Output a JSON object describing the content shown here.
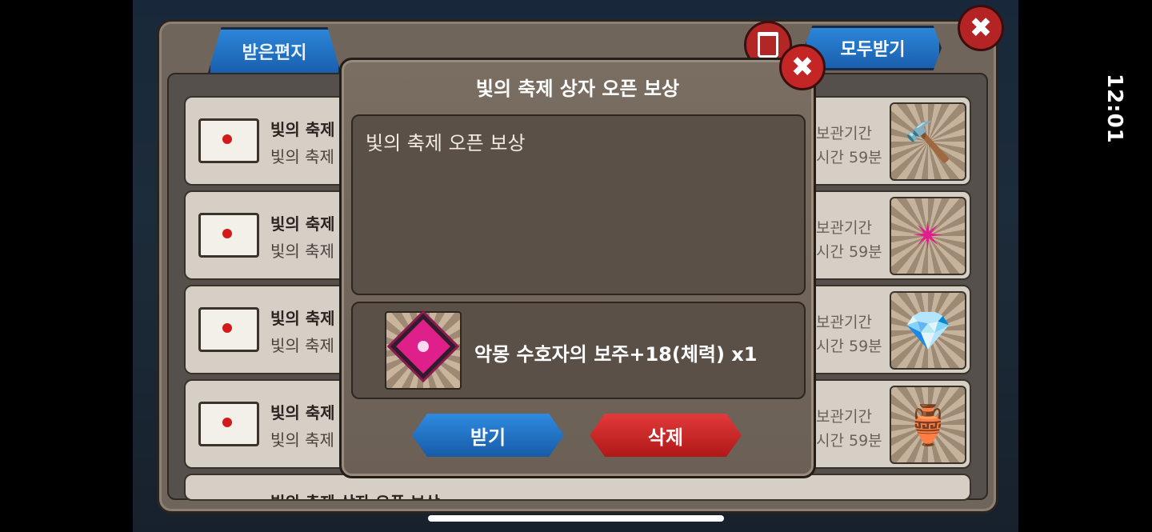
{
  "status_bar": {
    "time": "12:01"
  },
  "mailbox": {
    "tab_label": "받은편지",
    "receive_all_label": "모두받기",
    "rows": [
      {
        "title": "빛의 축제",
        "subtitle": "빛의 축제",
        "expire_line1": "보관기간",
        "expire_line2": "시간 59분",
        "item_glyph": "🔨"
      },
      {
        "title": "빛의 축제",
        "subtitle": "빛의 축제",
        "expire_line1": "보관기간",
        "expire_line2": "시간 59분",
        "item_glyph": "✴"
      },
      {
        "title": "빛의 축제",
        "subtitle": "빛의 축제",
        "expire_line1": "보관기간",
        "expire_line2": "시간 59분",
        "item_glyph": "💎"
      },
      {
        "title": "빛의 축제",
        "subtitle": "빛의 축제",
        "expire_line1": "보관기간",
        "expire_line2": "시간 59분",
        "item_glyph": "🏺"
      }
    ],
    "partial_row_title": "빛의 축제 상자 오픈 보상"
  },
  "modal": {
    "title": "빛의 축제 상자 오픈 보상",
    "message": "빛의 축제 오픈 보상",
    "reward_text": "악몽 수호자의 보주+18(체력) x1",
    "receive_label": "받기",
    "delete_label": "삭제"
  },
  "colors": {
    "accent_blue": "#1f6fc4",
    "accent_red": "#c42525"
  }
}
